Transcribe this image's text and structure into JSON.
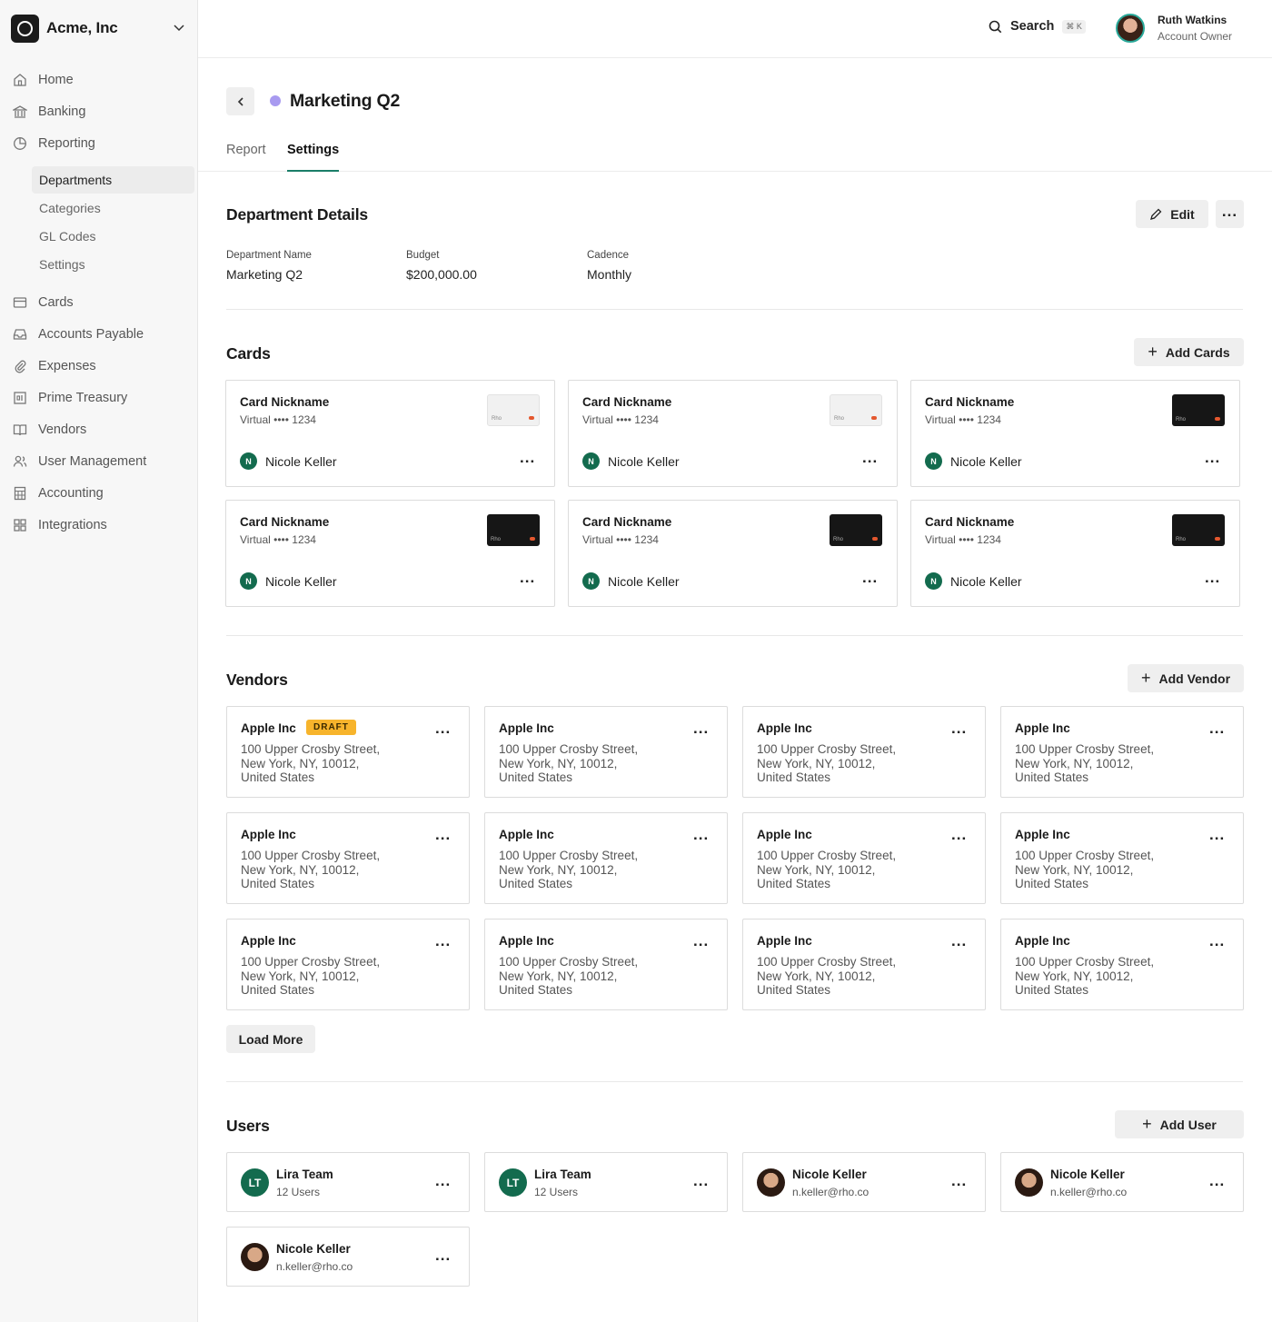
{
  "org": {
    "name": "Acme, Inc"
  },
  "nav": {
    "items": [
      {
        "label": "Home",
        "icon": "home-icon"
      },
      {
        "label": "Banking",
        "icon": "bank-icon"
      },
      {
        "label": "Reporting",
        "icon": "pie-chart-icon"
      },
      {
        "label": "Cards",
        "icon": "credit-card-icon"
      },
      {
        "label": "Accounts Payable",
        "icon": "inbox-icon"
      },
      {
        "label": "Expenses",
        "icon": "paperclip-icon"
      },
      {
        "label": "Prime Treasury",
        "icon": "treasury-icon"
      },
      {
        "label": "Vendors",
        "icon": "book-icon"
      },
      {
        "label": "User Management",
        "icon": "users-icon"
      },
      {
        "label": "Accounting",
        "icon": "calculator-icon"
      },
      {
        "label": "Integrations",
        "icon": "grid-icon"
      }
    ],
    "sub": [
      "Departments",
      "Categories",
      "GL Codes",
      "Settings"
    ]
  },
  "header": {
    "search_label": "Search",
    "shortcut": "⌘ K",
    "user_name": "Ruth Watkins",
    "user_role": "Account Owner"
  },
  "page": {
    "title": "Marketing Q2",
    "tabs": [
      "Report",
      "Settings"
    ]
  },
  "details": {
    "title": "Department Details",
    "edit_label": "Edit",
    "fields": [
      {
        "label": "Department Name",
        "value": "Marketing Q2"
      },
      {
        "label": "Budget",
        "value": "$200,000.00"
      },
      {
        "label": "Cadence",
        "value": "Monthly"
      }
    ]
  },
  "cards": {
    "title": "Cards",
    "add_label": "Add Cards",
    "items": [
      {
        "name": "Card Nickname",
        "sub": "Virtual •••• 1234",
        "owner": "Nicole Keller",
        "initial": "N",
        "style": "light"
      },
      {
        "name": "Card Nickname",
        "sub": "Virtual •••• 1234",
        "owner": "Nicole Keller",
        "initial": "N",
        "style": "light"
      },
      {
        "name": "Card Nickname",
        "sub": "Virtual •••• 1234",
        "owner": "Nicole Keller",
        "initial": "N",
        "style": "dark"
      },
      {
        "name": "Card Nickname",
        "sub": "Virtual •••• 1234",
        "owner": "Nicole Keller",
        "initial": "N",
        "style": "dark"
      },
      {
        "name": "Card Nickname",
        "sub": "Virtual •••• 1234",
        "owner": "Nicole Keller",
        "initial": "N",
        "style": "dark"
      },
      {
        "name": "Card Nickname",
        "sub": "Virtual •••• 1234",
        "owner": "Nicole Keller",
        "initial": "N",
        "style": "dark"
      }
    ]
  },
  "vendors": {
    "title": "Vendors",
    "add_label": "Add Vendor",
    "load_more": "Load More",
    "draft_label": "DRAFT",
    "items": [
      {
        "name": "Apple Inc",
        "addr": "100 Upper Crosby Street,\nNew York, NY, 10012,\nUnited States"
      },
      {
        "name": "Apple Inc",
        "addr": "100 Upper Crosby Street,\nNew York, NY, 10012,\nUnited States"
      },
      {
        "name": "Apple Inc",
        "addr": "100 Upper Crosby Street,\nNew York, NY, 10012,\nUnited States"
      },
      {
        "name": "Apple Inc",
        "addr": "100 Upper Crosby Street,\nNew York, NY, 10012,\nUnited States"
      },
      {
        "name": "Apple Inc",
        "addr": "100 Upper Crosby Street,\nNew York, NY, 10012,\nUnited States"
      },
      {
        "name": "Apple Inc",
        "addr": "100 Upper Crosby Street,\nNew York, NY, 10012,\nUnited States"
      },
      {
        "name": "Apple Inc",
        "addr": "100 Upper Crosby Street,\nNew York, NY, 10012,\nUnited States"
      },
      {
        "name": "Apple Inc",
        "addr": "100 Upper Crosby Street,\nNew York, NY, 10012,\nUnited States"
      },
      {
        "name": "Apple Inc",
        "addr": "100 Upper Crosby Street,\nNew York, NY, 10012,\nUnited States"
      },
      {
        "name": "Apple Inc",
        "addr": "100 Upper Crosby Street,\nNew York, NY, 10012,\nUnited States"
      },
      {
        "name": "Apple Inc",
        "addr": "100 Upper Crosby Street,\nNew York, NY, 10012,\nUnited States"
      },
      {
        "name": "Apple Inc",
        "addr": "100 Upper Crosby Street,\nNew York, NY, 10012,\nUnited States"
      }
    ]
  },
  "users": {
    "title": "Users",
    "add_label": "Add User",
    "items": [
      {
        "name": "Lira Team",
        "sub": "12 Users",
        "initials": "LT",
        "kind": "team"
      },
      {
        "name": "Lira Team",
        "sub": "12 Users",
        "initials": "LT",
        "kind": "team"
      },
      {
        "name": "Nicole Keller",
        "sub": "n.keller@rho.co",
        "initials": "",
        "kind": "photo"
      },
      {
        "name": "Nicole Keller",
        "sub": "n.keller@rho.co",
        "initials": "",
        "kind": "photo"
      },
      {
        "name": "Nicole Keller",
        "sub": "n.keller@rho.co",
        "initials": "",
        "kind": "photo"
      }
    ]
  }
}
